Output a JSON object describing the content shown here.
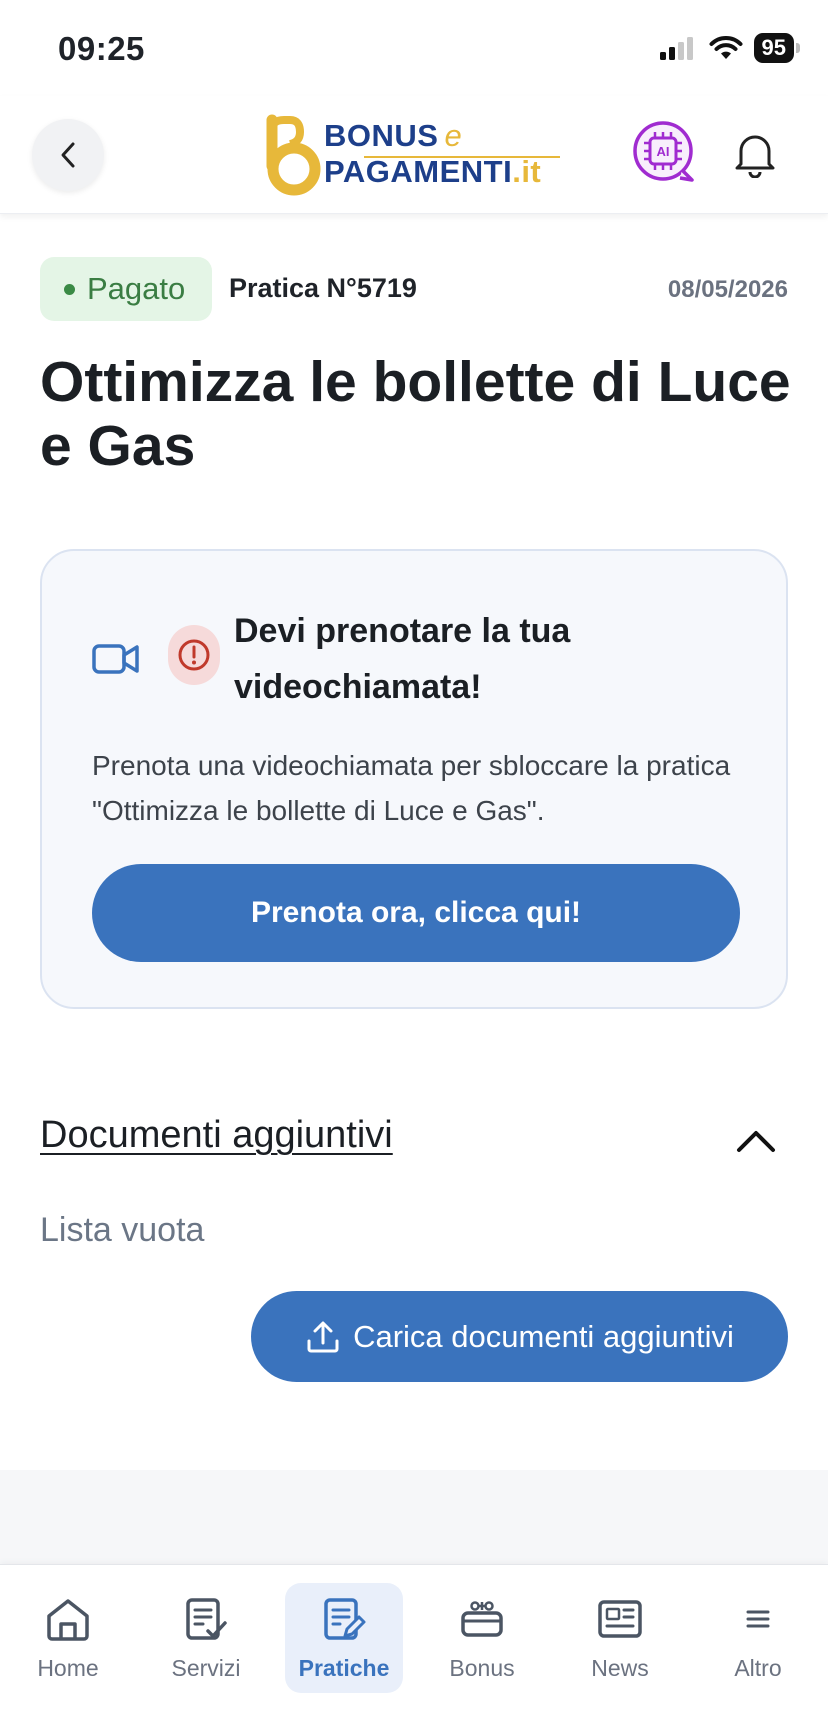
{
  "status_bar": {
    "time": "09:25",
    "battery": "95"
  },
  "header": {
    "logo": {
      "line1": "BONUS",
      "line1_e": "e",
      "line2": "PAGAMENTI",
      "line2_suffix": ".it",
      "ai_label": "AI"
    },
    "colors": {
      "brand_blue": "#1d3f8a",
      "brand_yellow": "#e7b83a",
      "ai_purple": "#a02bd0"
    }
  },
  "practice": {
    "status": "Pagato",
    "number": "Pratica N°5719",
    "date": "08/05/2026",
    "title": "Ottimizza le bollette di Luce e Gas"
  },
  "alert_card": {
    "icons": [
      "video-camera-icon",
      "alert-circle-icon"
    ],
    "title": "Devi prenotare la tua videochiamata!",
    "text": "Prenota una videochiamata per sbloccare la pratica \"Ottimizza le bollette di Luce e Gas\".",
    "button": "Prenota ora, clicca qui!"
  },
  "documents": {
    "title": "Documenti aggiuntivi",
    "empty_text": "Lista vuota",
    "upload_button": "Carica documenti aggiuntivi"
  },
  "bottom_nav": {
    "items": [
      {
        "label": "Home",
        "icon": "home-icon"
      },
      {
        "label": "Servizi",
        "icon": "servizi-icon"
      },
      {
        "label": "Pratiche",
        "icon": "pratiche-icon",
        "active": true
      },
      {
        "label": "Bonus",
        "icon": "bonus-icon"
      },
      {
        "label": "News",
        "icon": "news-icon"
      },
      {
        "label": "Altro",
        "icon": "menu-icon"
      }
    ]
  },
  "colors": {
    "primary": "#3a73bd",
    "success_bg": "#e4f5e6",
    "success_text": "#3a7d43",
    "alert_red": "#c0392b"
  }
}
